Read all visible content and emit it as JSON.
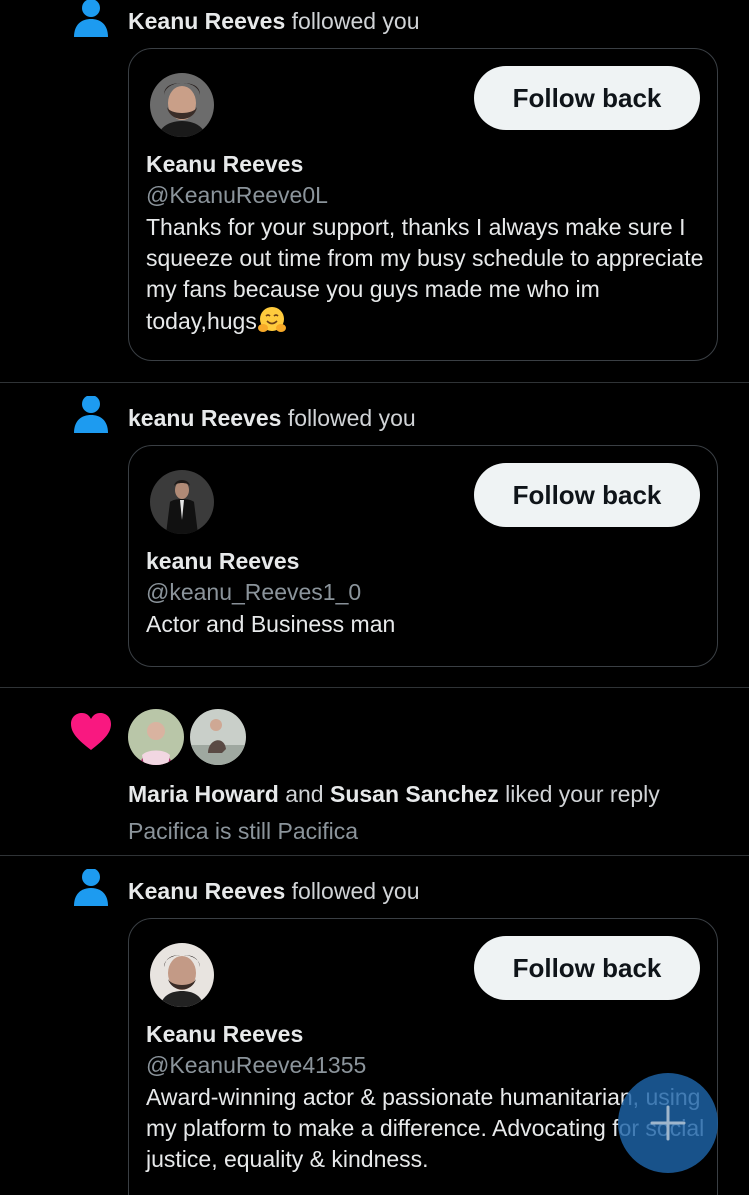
{
  "colors": {
    "accent": "#1d9bf0",
    "heart": "#f91880",
    "background": "#000000",
    "button_bg": "#eff3f4"
  },
  "notifications": [
    {
      "type": "follow",
      "icon": "person-icon",
      "actor": "Keanu Reeves",
      "action": "followed you",
      "card": {
        "button": "Follow back",
        "name": "Keanu Reeves",
        "handle": "@KeanuReeve0L",
        "bio": "Thanks for your support, thanks I always make sure I squeeze out time from my busy schedule to appreciate my fans because you guys made me who im today,hugs",
        "bio_emoji": "hugging-face-emoji"
      }
    },
    {
      "type": "follow",
      "icon": "person-icon",
      "actor": "keanu Reeves",
      "action": "followed you",
      "card": {
        "button": "Follow back",
        "name": "keanu Reeves",
        "handle": "@keanu_Reeves1_0",
        "bio": "Actor and Business man"
      }
    },
    {
      "type": "like",
      "icon": "heart-icon",
      "actor1": "Maria Howard",
      "conj": "and",
      "actor2": "Susan Sanchez",
      "action": "liked your reply",
      "reply_text": "Pacifica is still Pacifica"
    },
    {
      "type": "follow",
      "icon": "person-icon",
      "actor": "Keanu Reeves",
      "action": "followed you",
      "card": {
        "button": "Follow back",
        "name": "Keanu Reeves",
        "handle": "@KeanuReeve41355",
        "bio": "Award-winning actor & passionate humanitarian, using my platform to make a difference. Advocating for social justice, equality & kindness."
      }
    }
  ],
  "fab": {
    "icon": "plus-icon"
  }
}
